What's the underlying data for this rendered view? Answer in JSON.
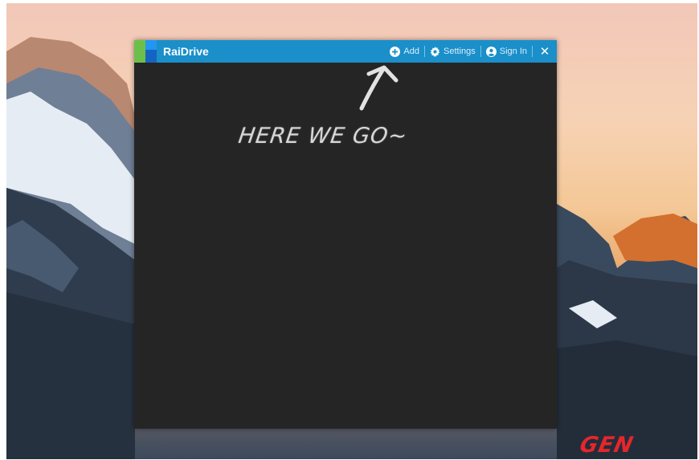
{
  "app": {
    "title": "RaiDrive"
  },
  "toolbar": {
    "add_label": "Add",
    "settings_label": "Settings",
    "signin_label": "Sign In",
    "close_glyph": "✕"
  },
  "annotation": {
    "text": "HERE WE GO~"
  },
  "watermark": {
    "text": "GEN"
  },
  "colors": {
    "titlebar": "#1a8fc9",
    "window_body": "#252525",
    "logo_green": "#6cc04a",
    "logo_blue": "#1565c0",
    "watermark": "#e5262b"
  },
  "icons": {
    "add": "plus-circle-icon",
    "settings": "gear-icon",
    "signin": "user-circle-icon",
    "close": "close-icon"
  }
}
